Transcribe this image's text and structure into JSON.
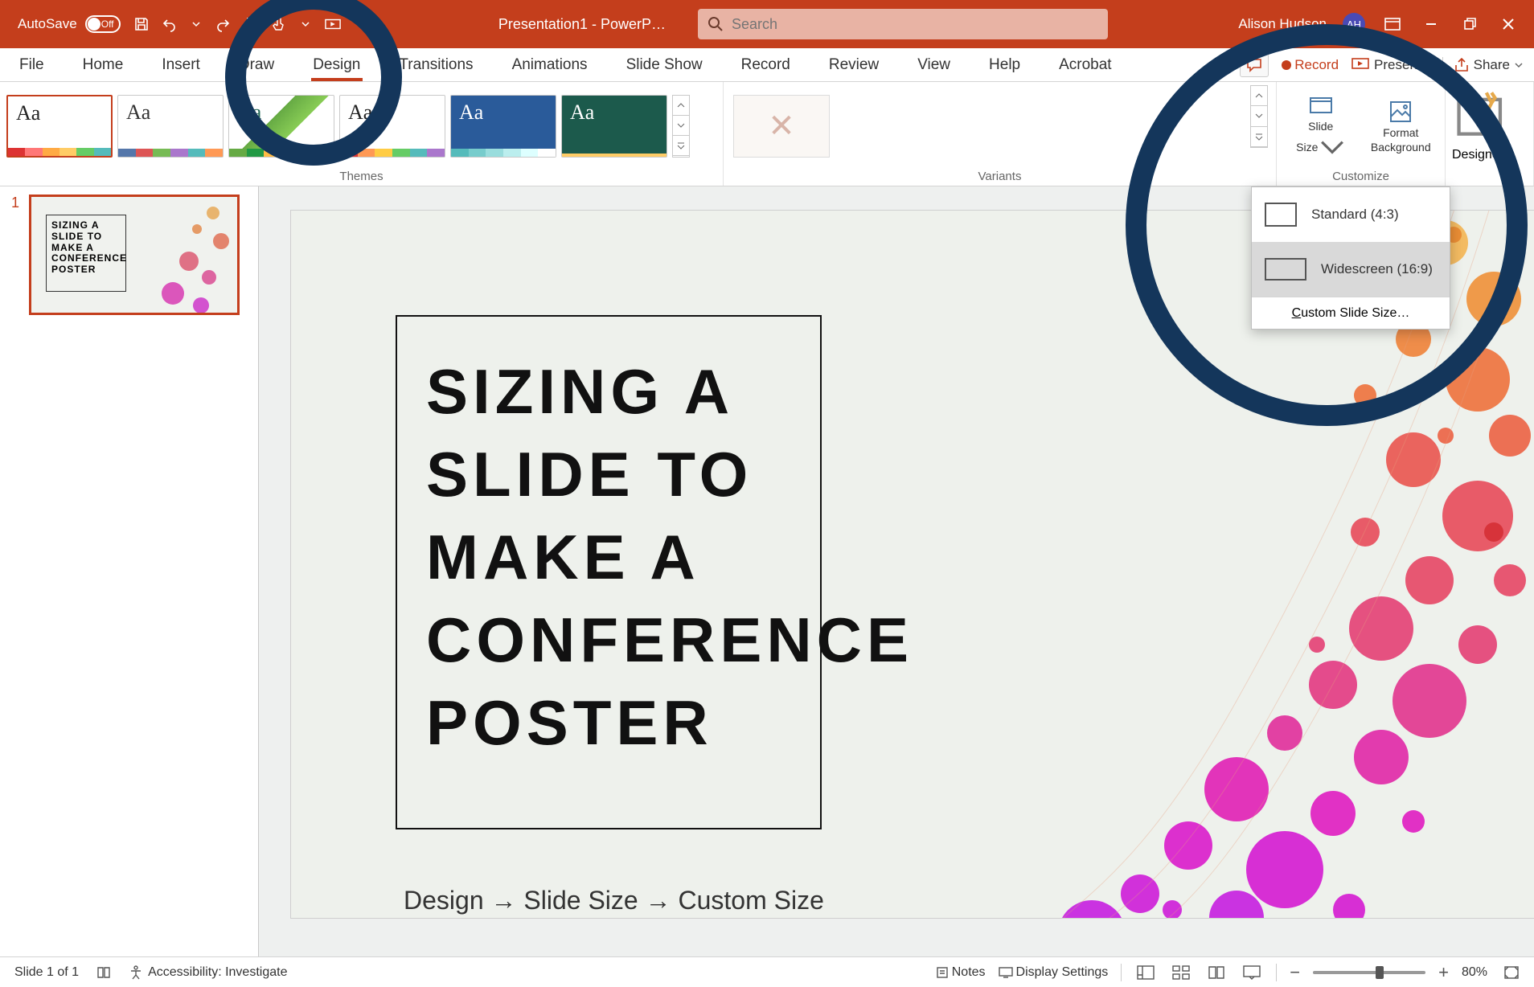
{
  "titlebar": {
    "autosave_label": "AutoSave",
    "autosave_state": "Off",
    "document_title": "Presentation1 - PowerP…",
    "search_placeholder": "Search",
    "user_name": "Alison Hudson",
    "user_initials": "AH"
  },
  "tabs": [
    "File",
    "Home",
    "Insert",
    "Draw",
    "Design",
    "Transitions",
    "Animations",
    "Slide Show",
    "Record",
    "Review",
    "View",
    "Help",
    "Acrobat"
  ],
  "active_tab": "Design",
  "ribbon_right": {
    "record": "Record",
    "present": "Present",
    "share": "Share"
  },
  "ribbon": {
    "themes_group": "Themes",
    "variants_group": "Variants",
    "customize_group": "Customize",
    "slide_size": "Slide",
    "slide_size2": "Size",
    "format_bg": "Format",
    "format_bg2": "Background",
    "designer": "Designer"
  },
  "slide_size_menu": {
    "standard": "Standard (4:3)",
    "widescreen": "Widescreen (16:9)",
    "custom": "ustom Slide Size…",
    "custom_u": "C"
  },
  "thumbnail": {
    "number": "1"
  },
  "slide": {
    "title": "SIZING A SLIDE TO MAKE A CONFERENCE POSTER",
    "subtitle": "Design → Slide Size → Custom Size"
  },
  "status": {
    "slide_count": "Slide 1 of 1",
    "accessibility": "Accessibility: Investigate",
    "notes": "Notes",
    "display": "Display Settings",
    "zoom": "80%"
  }
}
